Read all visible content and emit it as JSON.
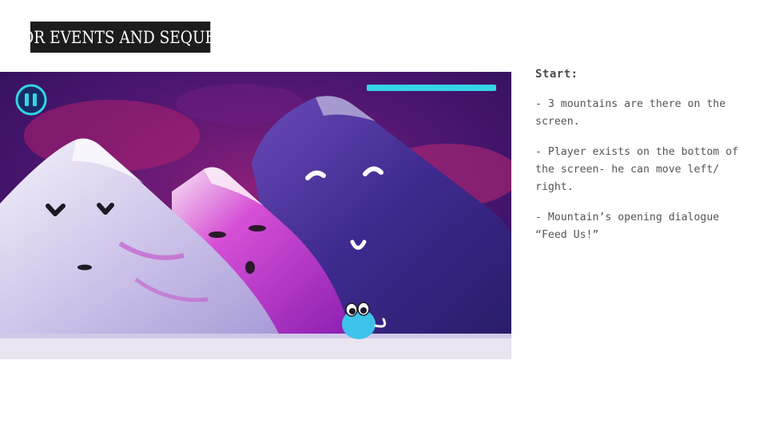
{
  "slide": {
    "title": "MAJOR EVENTS AND SEQUENCE"
  },
  "game_screen": {
    "pause_icon": "pause-icon",
    "health_bar": {
      "color": "#35d4e6",
      "level": 1.0
    },
    "player_color": "#3dc3ea",
    "colors": {
      "sky": "#3a1466",
      "sky_glow": "#c2247a",
      "mountain_left": "#d8d2ee",
      "mountain_mid": "#c93ad1",
      "mountain_right": "#4a2aa0",
      "ground": "#e8e4f0"
    }
  },
  "notes": {
    "heading": "Start:",
    "items": [
      "- 3 mountains are there on the screen.",
      "- Player exists on the bottom of the screen- he can move left/ right.",
      "- Mountain’s opening dialogue “Feed Us!”"
    ]
  }
}
